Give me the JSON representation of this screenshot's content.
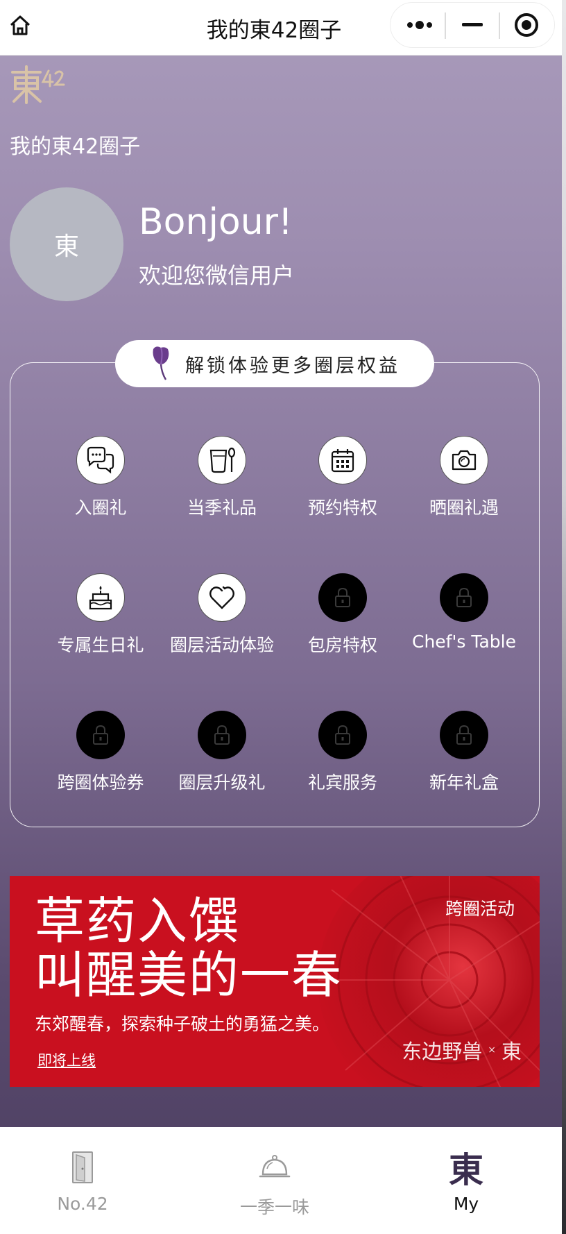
{
  "header": {
    "title": "我的東42圈子"
  },
  "colors": {
    "bg_top": "#a99bbb",
    "bg_bottom": "#4b3e60",
    "banner_red": "#c9101f",
    "logo_gold": "#d9c3a7"
  },
  "profile": {
    "section_title": "我的東42圈子",
    "avatar_text": "東",
    "greeting": "Bonjour!",
    "welcome": "欢迎您微信用户"
  },
  "benefits": {
    "unlock_label": "解锁体验更多圈层权益",
    "items": [
      {
        "label": "入圈礼",
        "icon": "chat-bubbles-icon",
        "locked": false
      },
      {
        "label": "当季礼品",
        "icon": "cup-spoon-icon",
        "locked": false
      },
      {
        "label": "预约特权",
        "icon": "calendar-icon",
        "locked": false
      },
      {
        "label": "晒圈礼遇",
        "icon": "camera-icon",
        "locked": false
      },
      {
        "label": "专属生日礼",
        "icon": "cake-icon",
        "locked": false
      },
      {
        "label": "圈层活动体验",
        "icon": "heart-icon",
        "locked": false
      },
      {
        "label": "包房特权",
        "icon": "lock-icon",
        "locked": true
      },
      {
        "label": "Chef's Table",
        "icon": "lock-icon",
        "locked": true
      },
      {
        "label": "跨圈体验券",
        "icon": "lock-icon",
        "locked": true
      },
      {
        "label": "圈层升级礼",
        "icon": "lock-icon",
        "locked": true
      },
      {
        "label": "礼宾服务",
        "icon": "lock-icon",
        "locked": true
      },
      {
        "label": "新年礼盒",
        "icon": "lock-icon",
        "locked": true
      }
    ]
  },
  "banner": {
    "headline_1": "草药入馔",
    "headline_2": "叫醒美的一春",
    "subtitle": "东郊醒春，探索种子破土的勇猛之美。",
    "cta": "即将上线",
    "tag": "跨圈活动",
    "brand_left": "东边野兽",
    "brand_x": "×",
    "brand_right": "東"
  },
  "nav": {
    "items": [
      {
        "label": "No.42",
        "icon": "door-icon",
        "active": false
      },
      {
        "label": "一季一味",
        "icon": "cloche-icon",
        "active": false
      },
      {
        "label": "My",
        "icon": "dong-char-icon",
        "active": true
      }
    ],
    "my_icon_text": "東"
  }
}
